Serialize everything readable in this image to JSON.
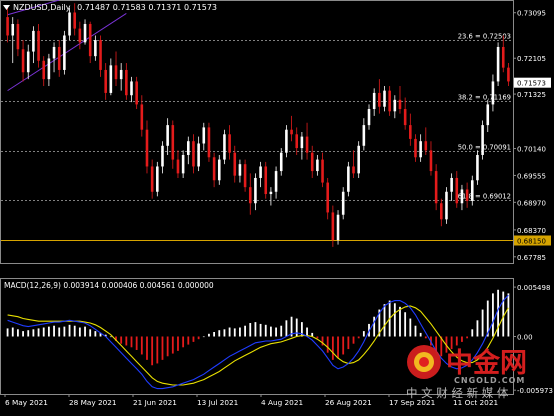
{
  "colors": {
    "background": "#000000",
    "frame": "#8a8a8a",
    "grid": "#5a5a5a",
    "bull": "#ffffff",
    "bear": "#e41b1b",
    "text": "#ffffff",
    "fib": "#aaaaaa",
    "channel": "#7a33d6",
    "support_line": "#d6a400",
    "support_tag_bg": "#d6a400",
    "support_tag_text": "#000000",
    "price_tag_bg": "#ffffff",
    "price_tag_text": "#000000",
    "macd_hist_pos": "#ffffff",
    "macd_hist_neg": "#e41b1b",
    "macd_line": "#1f3cff",
    "signal_line": "#e8e000",
    "logo_red": "#e02020",
    "logo_yellow": "#f2b820"
  },
  "chart_data": [
    {
      "type": "candlestick",
      "symbol_header": "NZDUSD,Daily",
      "ohlc_header": "0.71487 0.71583 0.71371 0.71573",
      "current_price": 0.71573,
      "current_price_label": "0.71573",
      "ylim": [
        0.6765,
        0.7335
      ],
      "y_ticks": [
        {
          "value": 0.73095,
          "label": "0.73095"
        },
        {
          "value": 0.72105,
          "label": "0.72105"
        },
        {
          "value": 0.71325,
          "label": "0.71325"
        },
        {
          "value": 0.7014,
          "label": "0.70140"
        },
        {
          "value": 0.69555,
          "label": "0.69555"
        },
        {
          "value": 0.6897,
          "label": "0.68970"
        },
        {
          "value": 0.6837,
          "label": "0.68370"
        },
        {
          "value": 0.67785,
          "label": "0.67785"
        }
      ],
      "fib_levels": [
        {
          "value": 0.72503,
          "label": "23.6 = 0.72503"
        },
        {
          "value": 0.71169,
          "label": "38.2 = 0.71169"
        },
        {
          "value": 0.70091,
          "label": "50.0 = 0.70091"
        },
        {
          "value": 0.69012,
          "label": "61.8 = 0.69012"
        }
      ],
      "support_level": {
        "value": 0.6815,
        "label": "0.68150"
      },
      "channel_lines": [
        {
          "from": {
            "bar": 0,
            "price": 0.7305
          },
          "to": {
            "bar": 10,
            "price": 0.7337
          }
        },
        {
          "from": {
            "bar": 0,
            "price": 0.714
          },
          "to": {
            "bar": 23,
            "price": 0.7308
          }
        }
      ],
      "candles": [
        [
          0.73,
          0.732,
          0.7245,
          0.726
        ],
        [
          0.726,
          0.73,
          0.72,
          0.7285
        ],
        [
          0.7285,
          0.7295,
          0.7215,
          0.723
        ],
        [
          0.723,
          0.725,
          0.716,
          0.718
        ],
        [
          0.718,
          0.724,
          0.7165,
          0.7225
        ],
        [
          0.7225,
          0.728,
          0.72,
          0.727
        ],
        [
          0.727,
          0.7285,
          0.719,
          0.7205
        ],
        [
          0.7205,
          0.7215,
          0.715,
          0.7165
        ],
        [
          0.7165,
          0.722,
          0.715,
          0.721
        ],
        [
          0.721,
          0.7245,
          0.718,
          0.7235
        ],
        [
          0.7235,
          0.725,
          0.717,
          0.7185
        ],
        [
          0.7185,
          0.727,
          0.7175,
          0.726
        ],
        [
          0.726,
          0.732,
          0.725,
          0.731
        ],
        [
          0.731,
          0.733,
          0.726,
          0.7275
        ],
        [
          0.7275,
          0.729,
          0.723,
          0.7245
        ],
        [
          0.7245,
          0.7295,
          0.724,
          0.7285
        ],
        [
          0.7285,
          0.729,
          0.72,
          0.7215
        ],
        [
          0.7215,
          0.726,
          0.7205,
          0.725
        ],
        [
          0.725,
          0.726,
          0.717,
          0.7185
        ],
        [
          0.7185,
          0.72,
          0.712,
          0.7135
        ],
        [
          0.7135,
          0.721,
          0.713,
          0.7195
        ],
        [
          0.7195,
          0.7225,
          0.715,
          0.7165
        ],
        [
          0.7165,
          0.72,
          0.714,
          0.7185
        ],
        [
          0.7185,
          0.72,
          0.712,
          0.713
        ],
        [
          0.713,
          0.717,
          0.7115,
          0.716
        ],
        [
          0.716,
          0.717,
          0.71,
          0.711
        ],
        [
          0.711,
          0.713,
          0.704,
          0.7055
        ],
        [
          0.7055,
          0.7075,
          0.696,
          0.6975
        ],
        [
          0.6975,
          0.699,
          0.6905,
          0.692
        ],
        [
          0.692,
          0.6985,
          0.691,
          0.6975
        ],
        [
          0.6975,
          0.703,
          0.696,
          0.702
        ],
        [
          0.702,
          0.708,
          0.7,
          0.7065
        ],
        [
          0.7065,
          0.7075,
          0.697,
          0.699
        ],
        [
          0.699,
          0.701,
          0.695,
          0.696
        ],
        [
          0.696,
          0.701,
          0.695,
          0.7
        ],
        [
          0.7,
          0.704,
          0.698,
          0.703
        ],
        [
          0.703,
          0.7045,
          0.696,
          0.6975
        ],
        [
          0.6975,
          0.704,
          0.6965,
          0.7025
        ],
        [
          0.7025,
          0.707,
          0.701,
          0.706
        ],
        [
          0.706,
          0.707,
          0.6985,
          0.6995
        ],
        [
          0.6995,
          0.7005,
          0.693,
          0.6945
        ],
        [
          0.6945,
          0.7,
          0.6935,
          0.699
        ],
        [
          0.699,
          0.7055,
          0.698,
          0.7045
        ],
        [
          0.7045,
          0.7065,
          0.699,
          0.7005
        ],
        [
          0.7005,
          0.702,
          0.694,
          0.6955
        ],
        [
          0.6955,
          0.699,
          0.694,
          0.698
        ],
        [
          0.698,
          0.699,
          0.692,
          0.693
        ],
        [
          0.693,
          0.696,
          0.687,
          0.6895
        ],
        [
          0.6895,
          0.696,
          0.688,
          0.695
        ],
        [
          0.695,
          0.6985,
          0.693,
          0.6975
        ],
        [
          0.6975,
          0.6985,
          0.6905,
          0.6915
        ],
        [
          0.6915,
          0.693,
          0.689,
          0.692
        ],
        [
          0.692,
          0.6975,
          0.6905,
          0.6965
        ],
        [
          0.6965,
          0.7015,
          0.6955,
          0.7005
        ],
        [
          0.7005,
          0.7065,
          0.6995,
          0.7055
        ],
        [
          0.7055,
          0.7085,
          0.703,
          0.7045
        ],
        [
          0.7045,
          0.706,
          0.7,
          0.7015
        ],
        [
          0.7015,
          0.705,
          0.699,
          0.704
        ],
        [
          0.704,
          0.707,
          0.699,
          0.7005
        ],
        [
          0.7005,
          0.702,
          0.695,
          0.6965
        ],
        [
          0.6965,
          0.7,
          0.6955,
          0.699
        ],
        [
          0.699,
          0.7005,
          0.693,
          0.694
        ],
        [
          0.694,
          0.695,
          0.686,
          0.6875
        ],
        [
          0.6875,
          0.689,
          0.68,
          0.6815
        ],
        [
          0.6815,
          0.688,
          0.6805,
          0.687
        ],
        [
          0.687,
          0.693,
          0.686,
          0.692
        ],
        [
          0.692,
          0.6985,
          0.691,
          0.6975
        ],
        [
          0.6975,
          0.701,
          0.695,
          0.696
        ],
        [
          0.696,
          0.703,
          0.695,
          0.702
        ],
        [
          0.702,
          0.708,
          0.701,
          0.7065
        ],
        [
          0.7065,
          0.711,
          0.7055,
          0.71
        ],
        [
          0.71,
          0.7145,
          0.7085,
          0.7135
        ],
        [
          0.7135,
          0.7165,
          0.709,
          0.7105
        ],
        [
          0.7105,
          0.715,
          0.7095,
          0.714
        ],
        [
          0.714,
          0.715,
          0.7085,
          0.7095
        ],
        [
          0.7095,
          0.713,
          0.708,
          0.712
        ],
        [
          0.712,
          0.715,
          0.709,
          0.71
        ],
        [
          0.71,
          0.7125,
          0.7055,
          0.7065
        ],
        [
          0.7065,
          0.709,
          0.702,
          0.7035
        ],
        [
          0.7035,
          0.7045,
          0.6985,
          0.6995
        ],
        [
          0.6995,
          0.7045,
          0.6985,
          0.703
        ],
        [
          0.703,
          0.706,
          0.7,
          0.701
        ],
        [
          0.701,
          0.703,
          0.6955,
          0.6965
        ],
        [
          0.6965,
          0.698,
          0.688,
          0.6895
        ],
        [
          0.6895,
          0.6905,
          0.6845,
          0.686
        ],
        [
          0.686,
          0.693,
          0.685,
          0.692
        ],
        [
          0.692,
          0.696,
          0.69,
          0.695
        ],
        [
          0.695,
          0.6965,
          0.6885,
          0.6895
        ],
        [
          0.6895,
          0.6935,
          0.688,
          0.6925
        ],
        [
          0.6925,
          0.694,
          0.6885,
          0.69
        ],
        [
          0.69,
          0.6955,
          0.689,
          0.6945
        ],
        [
          0.6945,
          0.701,
          0.6935,
          0.7
        ],
        [
          0.7,
          0.7075,
          0.699,
          0.7065
        ],
        [
          0.7065,
          0.712,
          0.705,
          0.711
        ],
        [
          0.711,
          0.7175,
          0.7095,
          0.716
        ],
        [
          0.716,
          0.7245,
          0.715,
          0.7235
        ],
        [
          0.7235,
          0.726,
          0.718,
          0.719
        ],
        [
          0.719,
          0.72,
          0.715,
          0.716
        ]
      ],
      "x_labels": [
        "6 May 2021",
        "28 May 2021",
        "21 Jun 2021",
        "13 Jul 2021",
        "4 Aug 2021",
        "26 Aug 2021",
        "17 Sep 2021",
        "11 Oct 2021"
      ]
    },
    {
      "type": "macd",
      "header": "MACD(12,26,9) 0.003914 0.000406 0.004561 0.000000",
      "ylim": [
        -0.0064,
        0.0064
      ],
      "y_ticks": [
        {
          "value": 0.005498,
          "label": "0.005498"
        },
        {
          "value": 0.0,
          "label": "0.00"
        },
        {
          "value": -0.005973,
          "label": "-0.005973"
        }
      ],
      "histogram": [
        0.0009,
        0.001,
        0.0008,
        0.0006,
        0.0007,
        0.0008,
        0.0009,
        0.001,
        0.0011,
        0.0012,
        0.001,
        0.0011,
        0.0013,
        0.0012,
        0.001,
        0.0011,
        0.0008,
        0.0006,
        0.0004,
        0.0002,
        0.0,
        -0.0005,
        -0.0008,
        -0.001,
        -0.0012,
        -0.0015,
        -0.002,
        -0.0026,
        -0.0032,
        -0.003,
        -0.0026,
        -0.0022,
        -0.0019,
        -0.0016,
        -0.0012,
        -0.0009,
        -0.0006,
        -0.0003,
        0.0,
        0.0003,
        0.0005,
        0.0007,
        0.0008,
        0.001,
        0.0009,
        0.001,
        0.0012,
        0.0015,
        0.0016,
        0.0014,
        0.0013,
        0.0011,
        0.001,
        0.0012,
        0.0018,
        0.0022,
        0.002,
        0.0016,
        0.001,
        0.0004,
        -0.0002,
        -0.001,
        -0.0018,
        -0.0026,
        -0.0024,
        -0.002,
        -0.0014,
        -0.0008,
        -0.0002,
        0.0006,
        0.0014,
        0.0022,
        0.003,
        0.0036,
        0.004,
        0.0037,
        0.0033,
        0.0027,
        0.002,
        0.0012,
        0.0004,
        -0.0002,
        -0.001,
        -0.0016,
        -0.0022,
        -0.0018,
        -0.0014,
        -0.001,
        -0.0006,
        -0.0002,
        0.0008,
        0.0018,
        0.003,
        0.004,
        0.0048,
        0.0052,
        0.005,
        0.0048
      ],
      "macd_line": [
        0.0018,
        0.0016,
        0.0014,
        0.0012,
        0.0011,
        0.0012,
        0.0013,
        0.0014,
        0.0015,
        0.0016,
        0.0016,
        0.0017,
        0.0018,
        0.0017,
        0.0016,
        0.0015,
        0.0012,
        0.0008,
        0.0004,
        0.0,
        -0.0006,
        -0.0012,
        -0.0018,
        -0.0024,
        -0.003,
        -0.0036,
        -0.0042,
        -0.005,
        -0.0056,
        -0.0058,
        -0.0058,
        -0.0057,
        -0.0056,
        -0.0054,
        -0.0052,
        -0.005,
        -0.0048,
        -0.0045,
        -0.0042,
        -0.0038,
        -0.0034,
        -0.003,
        -0.0026,
        -0.0022,
        -0.0019,
        -0.0016,
        -0.0013,
        -0.001,
        -0.0007,
        -0.0006,
        -0.0005,
        -0.0005,
        -0.0004,
        -0.0003,
        0.0,
        0.0003,
        0.0004,
        0.0003,
        0.0,
        -0.0004,
        -0.001,
        -0.0016,
        -0.0024,
        -0.0032,
        -0.0036,
        -0.0034,
        -0.003,
        -0.0024,
        -0.0016,
        -0.0006,
        0.0006,
        0.0016,
        0.0026,
        0.0034,
        0.0038,
        0.004,
        0.004,
        0.0037,
        0.0032,
        0.0024,
        0.0014,
        0.0004,
        -0.0006,
        -0.0016,
        -0.0024,
        -0.003,
        -0.0034,
        -0.0036,
        -0.0035,
        -0.0032,
        -0.0026,
        -0.0018,
        -0.0008,
        0.0004,
        0.0016,
        0.003,
        0.004,
        0.0046
      ],
      "signal_line": [
        0.0024,
        0.0023,
        0.0022,
        0.002,
        0.0019,
        0.0018,
        0.0017,
        0.0017,
        0.0017,
        0.0017,
        0.0017,
        0.0017,
        0.0017,
        0.0017,
        0.0017,
        0.0016,
        0.0015,
        0.0013,
        0.001,
        0.0006,
        0.0002,
        -0.0004,
        -0.001,
        -0.0016,
        -0.0022,
        -0.0028,
        -0.0034,
        -0.004,
        -0.0046,
        -0.005,
        -0.0052,
        -0.0053,
        -0.0054,
        -0.0054,
        -0.0054,
        -0.0053,
        -0.0052,
        -0.005,
        -0.0048,
        -0.0045,
        -0.0042,
        -0.0039,
        -0.0035,
        -0.0031,
        -0.0027,
        -0.0024,
        -0.0021,
        -0.0018,
        -0.0015,
        -0.0012,
        -0.001,
        -0.0008,
        -0.0007,
        -0.0006,
        -0.0004,
        -0.0002,
        0.0,
        0.0001,
        0.0001,
        0.0,
        -0.0003,
        -0.0007,
        -0.0012,
        -0.0018,
        -0.0024,
        -0.0028,
        -0.003,
        -0.0029,
        -0.0026,
        -0.002,
        -0.0013,
        -0.0005,
        0.0004,
        0.0012,
        0.002,
        0.0026,
        0.003,
        0.0033,
        0.0034,
        0.0032,
        0.0028,
        0.0021,
        0.0014,
        0.0006,
        -0.0002,
        -0.001,
        -0.0017,
        -0.0023,
        -0.0027,
        -0.0029,
        -0.0029,
        -0.0026,
        -0.002,
        -0.0012,
        -0.0002,
        0.001,
        0.0022,
        0.0032
      ]
    }
  ],
  "watermark": {
    "brand": "中金网",
    "domain": "CNGOLD.COM",
    "slogan": "中 文 财 经 新 媒 体"
  }
}
